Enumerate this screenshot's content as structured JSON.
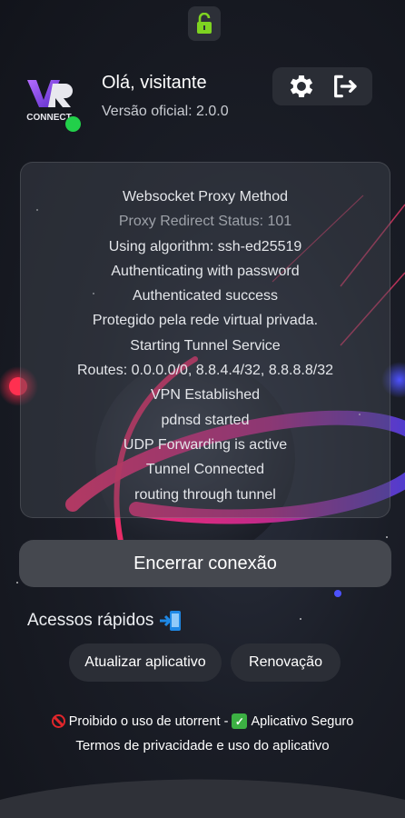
{
  "header": {
    "lock_icon": "unlocked-padlock-icon",
    "greeting": "Olá, visitante",
    "version": "Versão oficial: 2.0.0",
    "logo_text": "CONNECT",
    "status_color": "#22d04a",
    "actions": [
      "gear-icon",
      "logout-icon"
    ]
  },
  "log": {
    "lines": [
      "Websocket Proxy Method",
      "Proxy Redirect Status: 101",
      "Using algorithm: ssh-ed25519",
      "Authenticating with password",
      "Authenticated success",
      "Protegido pela rede virtual privada.",
      "Starting Tunnel Service",
      "Routes: 0.0.0.0/0, 8.8.4.4/32, 8.8.8.8/32",
      "VPN Established",
      "pdnsd started",
      "UDP Forwarding is active",
      "Tunnel Connected",
      "routing through tunnel"
    ]
  },
  "disconnect_button": "Encerrar conexão",
  "quick_access": {
    "title": "Acessos rápidos",
    "icon": "mobile-arrow-icon",
    "buttons": [
      "Atualizar aplicativo",
      "Renovação"
    ]
  },
  "footer": {
    "warning": "Proibido o uso de utorrent -",
    "safe": "Aplicativo Seguro",
    "terms": "Termos de privacidade e uso do aplicativo"
  }
}
